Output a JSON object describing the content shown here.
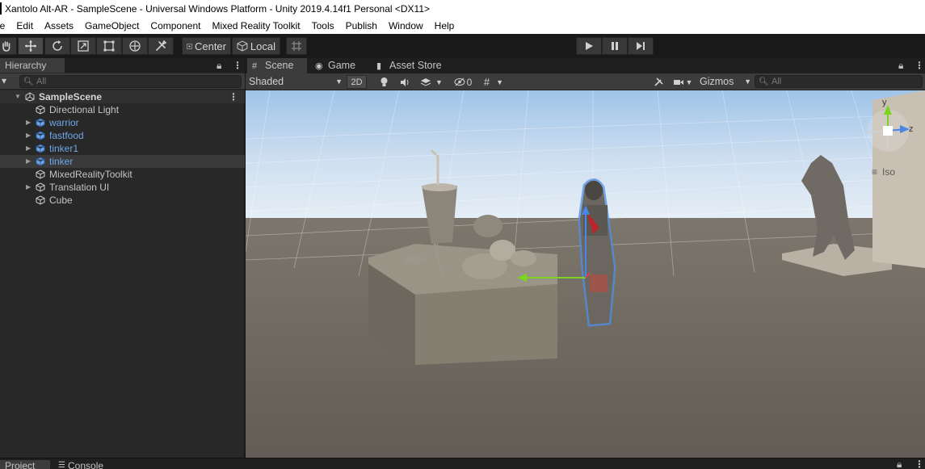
{
  "window": {
    "title": "Xantolo Alt-AR - SampleScene - Universal Windows Platform - Unity 2019.4.14f1 Personal <DX11>"
  },
  "menu": [
    "le",
    "Edit",
    "Assets",
    "GameObject",
    "Component",
    "Mixed Reality Toolkit",
    "Tools",
    "Publish",
    "Window",
    "Help"
  ],
  "toolbar": {
    "tools": [
      "hand-icon",
      "move-icon",
      "rotate-icon",
      "scale-icon",
      "rect-icon",
      "transform-icon",
      "custom-tool-icon"
    ],
    "active_tool": "move-icon",
    "pivot_mode": "Center",
    "pivot_rotation": "Local",
    "playback": [
      "play-icon",
      "pause-icon",
      "step-icon"
    ]
  },
  "hierarchy": {
    "tab_label": "Hierarchy",
    "add_label": "+",
    "dropdown_glyph": "▾",
    "search_placeholder": "All",
    "scene_name": "SampleScene",
    "items": [
      {
        "label": "Directional Light",
        "prefab": false,
        "expandable": false,
        "selected": false
      },
      {
        "label": "warrior",
        "prefab": true,
        "expandable": true,
        "selected": false
      },
      {
        "label": "fastfood",
        "prefab": true,
        "expandable": true,
        "selected": false
      },
      {
        "label": "tinker1",
        "prefab": true,
        "expandable": true,
        "selected": false
      },
      {
        "label": "tinker",
        "prefab": true,
        "expandable": true,
        "selected": true
      },
      {
        "label": "MixedRealityToolkit",
        "prefab": false,
        "expandable": false,
        "selected": false
      },
      {
        "label": "Translation UI",
        "prefab": false,
        "expandable": true,
        "selected": false
      },
      {
        "label": "Cube",
        "prefab": false,
        "expandable": false,
        "selected": false
      }
    ]
  },
  "scene": {
    "tabs": [
      {
        "label": "Scene",
        "icon": "grid-icon",
        "active": true
      },
      {
        "label": "Game",
        "icon": "gamepad-icon",
        "active": false
      },
      {
        "label": "Asset Store",
        "icon": "store-bag-icon",
        "active": false
      }
    ],
    "draw_mode": "Shaded",
    "mode_2d": "2D",
    "hidden_count": "0",
    "gizmos_label": "Gizmos",
    "search_placeholder": "All",
    "projection_label": "Iso",
    "axis_labels": {
      "y": "y",
      "z": "z"
    }
  },
  "bottom": {
    "tabs": [
      {
        "label": "Project",
        "active": true
      },
      {
        "label": "Console",
        "active": false
      }
    ]
  },
  "colors": {
    "prefab_text": "#6fa6e8",
    "selection_outline": "#4f8fe8",
    "axis_green": "#7ed321",
    "axis_blue": "#4a86e8",
    "axis_red": "#e04040"
  }
}
